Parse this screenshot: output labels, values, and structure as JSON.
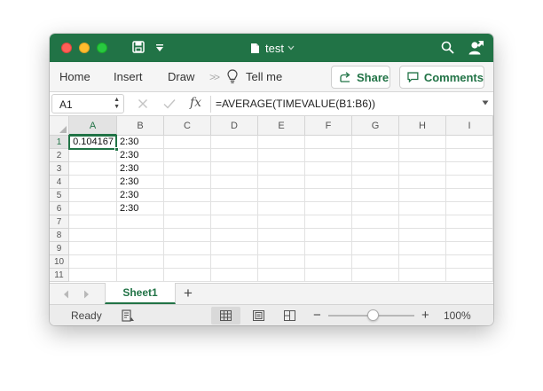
{
  "titlebar": {
    "title": "test",
    "bg_color": "#217346",
    "icons": [
      "close-icon",
      "minimize-icon",
      "maximize-icon",
      "save-icon",
      "customize-quick-access-icon",
      "document-icon",
      "chevron-down-icon",
      "search-icon",
      "share-person-icon"
    ]
  },
  "ribbon": {
    "tabs": [
      {
        "label": "Home"
      },
      {
        "label": "Insert"
      },
      {
        "label": "Draw"
      }
    ],
    "more_label": ">>",
    "tell_me_label": "Tell me",
    "share_label": "Share",
    "comments_label": "Comments",
    "accent_color": "#217346"
  },
  "formula_bar": {
    "name_box": "A1",
    "fx_label": "fx",
    "formula": "=AVERAGE(TIMEVALUE(B1:B6))"
  },
  "grid": {
    "columns": [
      "A",
      "B",
      "C",
      "D",
      "E",
      "F",
      "G",
      "H",
      "I"
    ],
    "rows": [
      "1",
      "2",
      "3",
      "4",
      "5",
      "6",
      "7",
      "8",
      "9",
      "10",
      "11"
    ],
    "selected_column": "A",
    "selected_row": "1",
    "cells": [
      {
        "ref": "A1",
        "value": "0.104167"
      },
      {
        "ref": "B1",
        "value": "2:30"
      },
      {
        "ref": "B2",
        "value": "2:30"
      },
      {
        "ref": "B3",
        "value": "2:30"
      },
      {
        "ref": "B4",
        "value": "2:30"
      },
      {
        "ref": "B5",
        "value": "2:30"
      },
      {
        "ref": "B6",
        "value": "2:30"
      }
    ]
  },
  "sheets": {
    "tabs": [
      {
        "label": "Sheet1"
      }
    ],
    "add_label": "+"
  },
  "status_bar": {
    "status": "Ready",
    "zoom_level": "100%",
    "zoom_value": 100
  }
}
